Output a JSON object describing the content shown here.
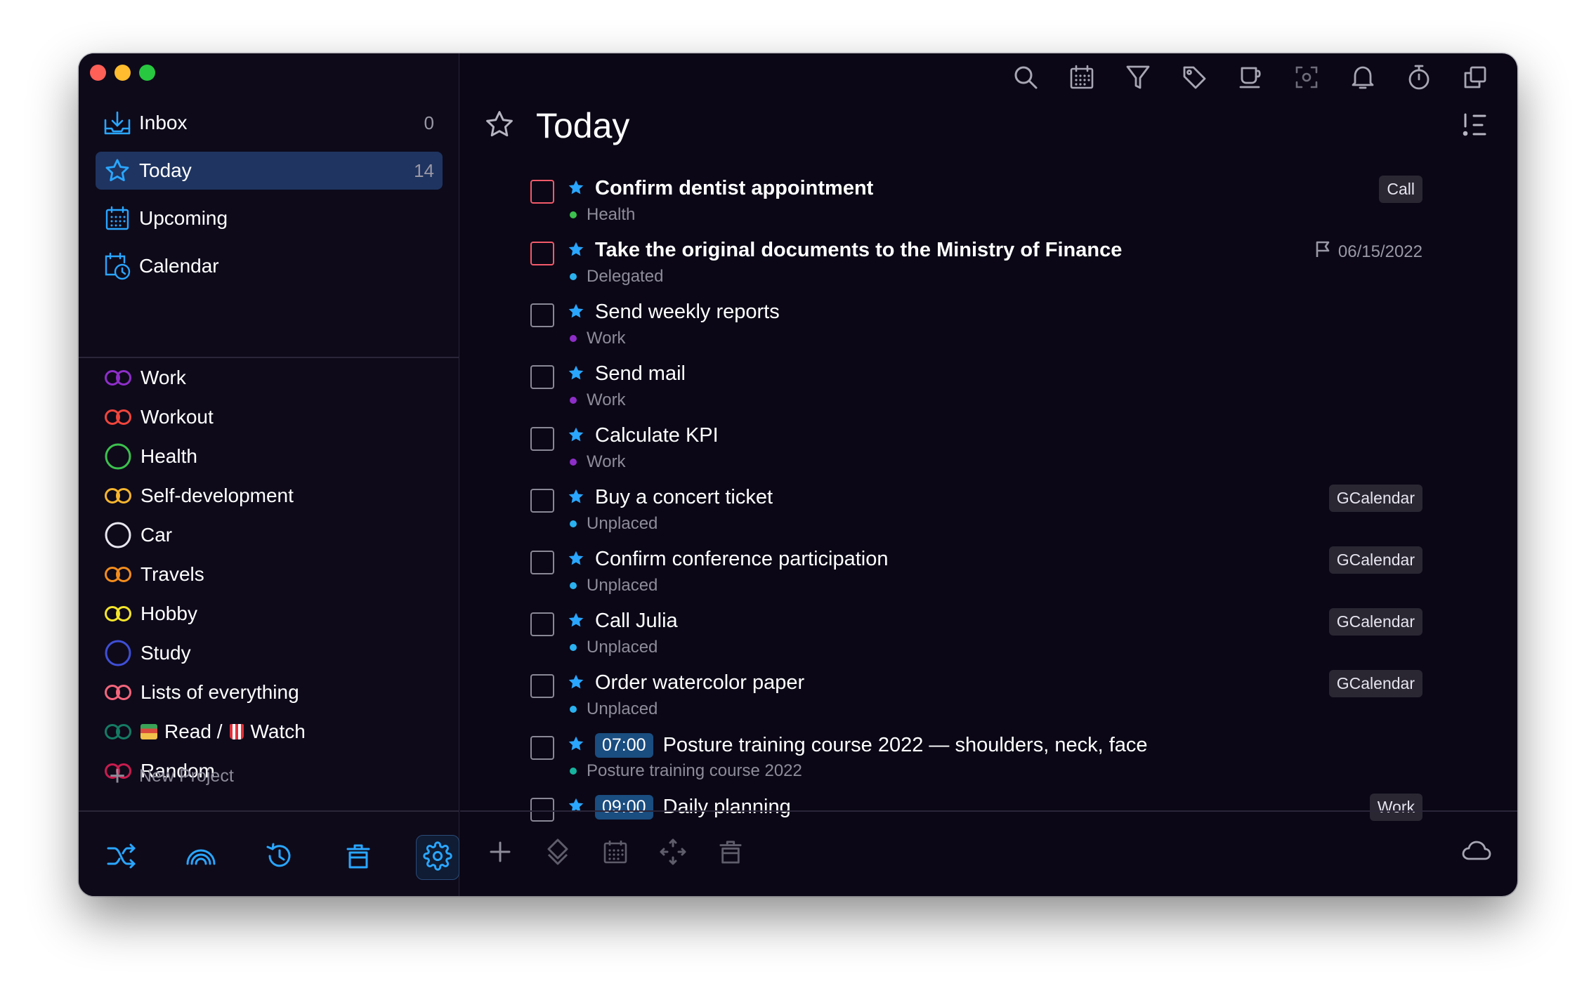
{
  "sidebar": {
    "nav": [
      {
        "label": "Inbox",
        "count": "0",
        "icon": "inbox-icon"
      },
      {
        "label": "Today",
        "count": "14",
        "icon": "star-icon"
      },
      {
        "label": "Upcoming",
        "count": "",
        "icon": "calendar-grid-icon"
      },
      {
        "label": "Calendar",
        "count": "",
        "icon": "calendar-clock-icon"
      }
    ],
    "projects": [
      {
        "label": "Work",
        "color": "#8e2ec8",
        "icon": "double-ring-icon"
      },
      {
        "label": "Workout",
        "color": "#f0453c",
        "icon": "double-ring-icon"
      },
      {
        "label": "Health",
        "color": "#3cc14e",
        "icon": "ring-icon"
      },
      {
        "label": "Self-development",
        "color": "#f6b52f",
        "icon": "double-ring-icon"
      },
      {
        "label": "Car",
        "color": "#e8e6ee",
        "icon": "ring-icon"
      },
      {
        "label": "Travels",
        "color": "#f28d1e",
        "icon": "double-ring-icon"
      },
      {
        "label": "Hobby",
        "color": "#f4e52c",
        "icon": "double-ring-icon"
      },
      {
        "label": "Study",
        "color": "#3f4fd6",
        "icon": "ring-icon"
      },
      {
        "label": "Lists of everything",
        "color": "#f4667c",
        "icon": "double-ring-icon"
      },
      {
        "label_a": "Read /",
        "label_b": "Watch",
        "color": "#157b63",
        "icon": "double-ring-icon"
      },
      {
        "label": "Random",
        "color": "#c81c4e",
        "icon": "double-ring-icon"
      }
    ],
    "new_project": "New Project",
    "bottom_icons": [
      "shuffle-icon",
      "rainbow-icon",
      "history-icon",
      "trash-icon",
      "settings-icon"
    ]
  },
  "main": {
    "title": "Today",
    "toolbar_icons": [
      "search-icon",
      "calendar-grid-icon",
      "filter-icon",
      "tag-icon",
      "coffee-icon",
      "focus-icon",
      "bell-icon",
      "timer-icon",
      "copy-icon"
    ],
    "tasks": [
      {
        "title": "Confirm dentist appointment",
        "bold": true,
        "red": true,
        "project": "Health",
        "dot": "#3cc14e",
        "tag": "Call"
      },
      {
        "title": "Take the original documents to the Ministry of Finance",
        "bold": true,
        "red": true,
        "project": "Delegated",
        "dot": "#2ab1f0",
        "date": "06/15/2022"
      },
      {
        "title": "Send weekly reports",
        "project": "Work",
        "dot": "#8e2ec8"
      },
      {
        "title": "Send mail",
        "project": "Work",
        "dot": "#8e2ec8"
      },
      {
        "title": "Calculate KPI",
        "project": "Work",
        "dot": "#8e2ec8"
      },
      {
        "title": "Buy a concert ticket",
        "project": "Unplaced",
        "dot": "#2ab1f0",
        "tag": "GCalendar"
      },
      {
        "title": "Confirm conference participation",
        "project": "Unplaced",
        "dot": "#2ab1f0",
        "tag": "GCalendar"
      },
      {
        "title": "Call Julia",
        "project": "Unplaced",
        "dot": "#2ab1f0",
        "tag": "GCalendar"
      },
      {
        "title": "Order watercolor paper",
        "project": "Unplaced",
        "dot": "#2ab1f0",
        "tag": "GCalendar"
      },
      {
        "title": "Posture training course 2022 — shoulders, neck, face",
        "time": "07:00",
        "project": "Posture training course 2022",
        "dot": "#17b4a0"
      },
      {
        "title": "Daily planning",
        "time": "09:00",
        "tag": "Work"
      }
    ],
    "bottom_icons": [
      "add-icon",
      "move-icon",
      "calendar-grid-icon",
      "arrows-icon",
      "trash-icon",
      "cloud-icon"
    ]
  },
  "colors": {
    "accent": "#2aa6ff",
    "background": "#0b0716",
    "sidebar": "#0e0a1a",
    "active": "#1f3460",
    "overdue": "#f35a6a"
  }
}
